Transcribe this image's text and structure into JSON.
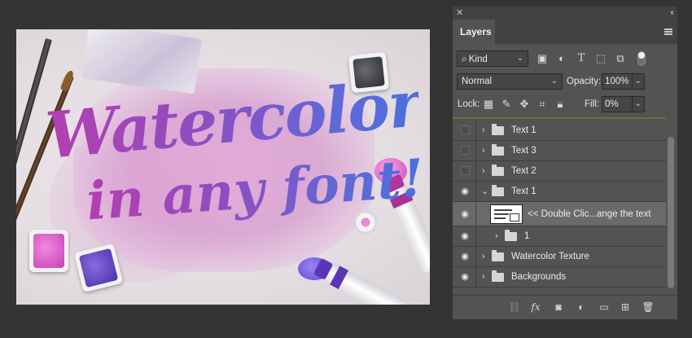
{
  "artwork": {
    "line1": "Watercolor",
    "line2": "in any font!"
  },
  "layers_panel": {
    "close_symbol": "✕",
    "collapse_symbol": "‹‹",
    "tab_label": "Layers",
    "menu_icon": "hamburger-icon",
    "filter": {
      "search_symbol": "⌕",
      "kind_value": "Kind",
      "filter_icons": [
        "image-filter-icon",
        "adjustment-filter-icon",
        "type-filter-icon",
        "shape-filter-icon",
        "smart-object-filter-icon"
      ]
    },
    "blend": {
      "mode_value": "Normal",
      "opacity_label": "Opacity:",
      "opacity_value": "100%"
    },
    "lock": {
      "label": "Lock:",
      "fill_label": "Fill:",
      "fill_value": "0%"
    },
    "layers": [
      {
        "name": "Text 1",
        "visible": false,
        "type": "group"
      },
      {
        "name": "Text 3",
        "visible": false,
        "type": "group"
      },
      {
        "name": "Text 2",
        "visible": false,
        "type": "group"
      },
      {
        "name": "Text 1",
        "visible": true,
        "type": "group",
        "expanded": true
      },
      {
        "name": "<< Double Clic...ange the text",
        "visible": true,
        "type": "smart-object",
        "selected": true
      },
      {
        "name": "1",
        "visible": true,
        "type": "group"
      },
      {
        "name": "Watercolor Texture",
        "visible": true,
        "type": "group"
      },
      {
        "name": "Backgrounds",
        "visible": true,
        "type": "group"
      }
    ],
    "bottom_icons": [
      "link-icon",
      "fx-icon",
      "mask-icon",
      "adjustment-icon",
      "new-group-icon",
      "new-layer-icon",
      "trash-icon"
    ],
    "fx_label": "fx"
  },
  "colors": {
    "panel_bg": "#535353",
    "selected_row": "#6a6a6a",
    "app_bg": "#343434"
  }
}
